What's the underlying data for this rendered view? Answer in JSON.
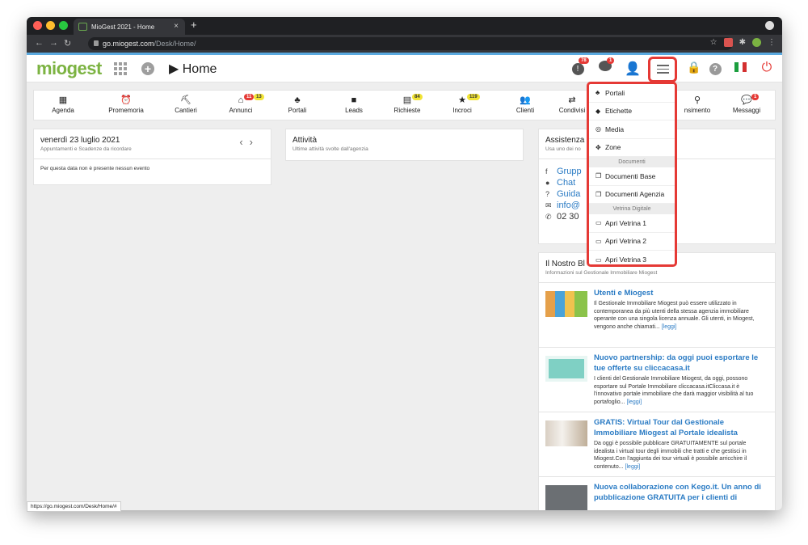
{
  "browser": {
    "tab_title": "MioGest 2021 - Home",
    "url_host": "go.miogest.com",
    "url_path": "/Desk/Home/",
    "status_url": "https://go.miogest.com/Desk/Home/#"
  },
  "header": {
    "logo": "miogest",
    "page_title": "Home",
    "badge_alerts": "78",
    "badge_messages": "1"
  },
  "toolbar": {
    "items": [
      {
        "label": "Agenda",
        "icon": "calendar-icon",
        "glyph": "▦"
      },
      {
        "label": "Promemoria",
        "icon": "alarm-icon",
        "glyph": "⏰"
      },
      {
        "label": "Cantieri",
        "icon": "crane-icon",
        "glyph": "⛏"
      },
      {
        "label": "Annunci",
        "icon": "house-icon",
        "glyph": "⌂",
        "badge_red": "11",
        "badge_yellow": "13"
      },
      {
        "label": "Portali",
        "icon": "sitemap-icon",
        "glyph": "♣"
      },
      {
        "label": "Leads",
        "icon": "chat-icon",
        "glyph": "■"
      },
      {
        "label": "Richieste",
        "icon": "grid-icon",
        "glyph": "▤",
        "badge_yellow": "84"
      },
      {
        "label": "Incroci",
        "icon": "star-icon",
        "glyph": "★",
        "badge_yellow": "119"
      },
      {
        "label": "Clienti",
        "icon": "users-icon",
        "glyph": "👥"
      },
      {
        "label": "Condivisi",
        "icon": "share-icon",
        "glyph": "⇄"
      },
      {
        "label": "nsimento",
        "icon": "pin-icon",
        "glyph": "⚲"
      },
      {
        "label": "Messaggi",
        "icon": "message-icon",
        "glyph": "💬",
        "badge_red": "1"
      }
    ]
  },
  "agenda": {
    "title": "venerdì 23 luglio 2021",
    "subtitle": "Appuntamenti e Scadenze da ricordare",
    "empty": "Per questa data non è presente nessun evento"
  },
  "activity": {
    "title": "Attività",
    "subtitle": "Ultime attività svolte dall'agenzia"
  },
  "support": {
    "title": "Assistenza",
    "subtitle": "Usa uno dei no",
    "rows": [
      {
        "icon": "facebook-icon",
        "glyph": "f",
        "text": "Grupp"
      },
      {
        "icon": "chat-icon",
        "glyph": "●",
        "text": "Chat"
      },
      {
        "icon": "help-icon",
        "glyph": "?",
        "text": "Guida"
      },
      {
        "icon": "mail-icon",
        "glyph": "✉",
        "text": "info@"
      },
      {
        "icon": "phone-icon",
        "glyph": "✆",
        "text": "02 30"
      }
    ]
  },
  "blog": {
    "title": "Il Nostro Bl",
    "subtitle": "Informazioni sul Gestionale Immobiliare Miogest",
    "posts": [
      {
        "title": "Utenti e Miogest",
        "text": "Il Gestionale Immobiliare Miogest può essere utilizzato in contemporanea da più utenti della stessa agenzia immobiliare operante con una singola licenza annuale. Gli utenti, in Miogest, vengono anche chiamati...",
        "more": "[leggi]"
      },
      {
        "title": "Nuovo partnership: da oggi puoi esportare le tue offerte su cliccacasa.it",
        "text": "I clienti del Gestionale Immobiliare Miogest, da oggi, possono esportare sul Portale Immobiliare cliccacasa.itCliccasa.it è l'innovativo portale immobiliare che darà maggior visibilità al tuo portafoglio...",
        "more": "[leggi]"
      },
      {
        "title": "GRATIS: Virtual Tour dal Gestionale Immobiliare Miogest al Portale idealista",
        "text": "Da oggi è possibile pubblicare GRATUITAMENTE sul portale idealista i virtual tour degli immobili che tratti e che gestisci in Miogest.Con l'aggiunta dei tour virtuali è possibile arricchire il contenuto...",
        "more": "[leggi]"
      },
      {
        "title": "Nuova collaborazione con Kego.it. Un anno di pubblicazione GRATUITA per i clienti di",
        "text": "",
        "more": ""
      }
    ]
  },
  "dropdown": {
    "items": [
      {
        "type": "item",
        "label": "Portali",
        "icon": "sitemap-icon",
        "glyph": "♣"
      },
      {
        "type": "item",
        "label": "Etichette",
        "icon": "tag-icon",
        "glyph": "◆"
      },
      {
        "type": "item",
        "label": "Media",
        "icon": "media-icon",
        "glyph": "◎"
      },
      {
        "type": "item",
        "label": "Zone",
        "icon": "map-pin-icon",
        "glyph": "✥"
      },
      {
        "type": "head",
        "label": "Documenti"
      },
      {
        "type": "item",
        "label": "Documenti Base",
        "icon": "copy-icon",
        "glyph": "❐"
      },
      {
        "type": "item",
        "label": "Documenti Agenzia",
        "icon": "copy-icon",
        "glyph": "❐"
      },
      {
        "type": "head",
        "label": "Vetrina Digitale"
      },
      {
        "type": "item",
        "label": "Apri Vetrina 1",
        "icon": "monitor-icon",
        "glyph": "▭"
      },
      {
        "type": "item",
        "label": "Apri Vetrina 2",
        "icon": "monitor-icon",
        "glyph": "▭"
      },
      {
        "type": "item",
        "label": "Apri Vetrina 3",
        "icon": "monitor-icon",
        "glyph": "▭"
      }
    ]
  }
}
